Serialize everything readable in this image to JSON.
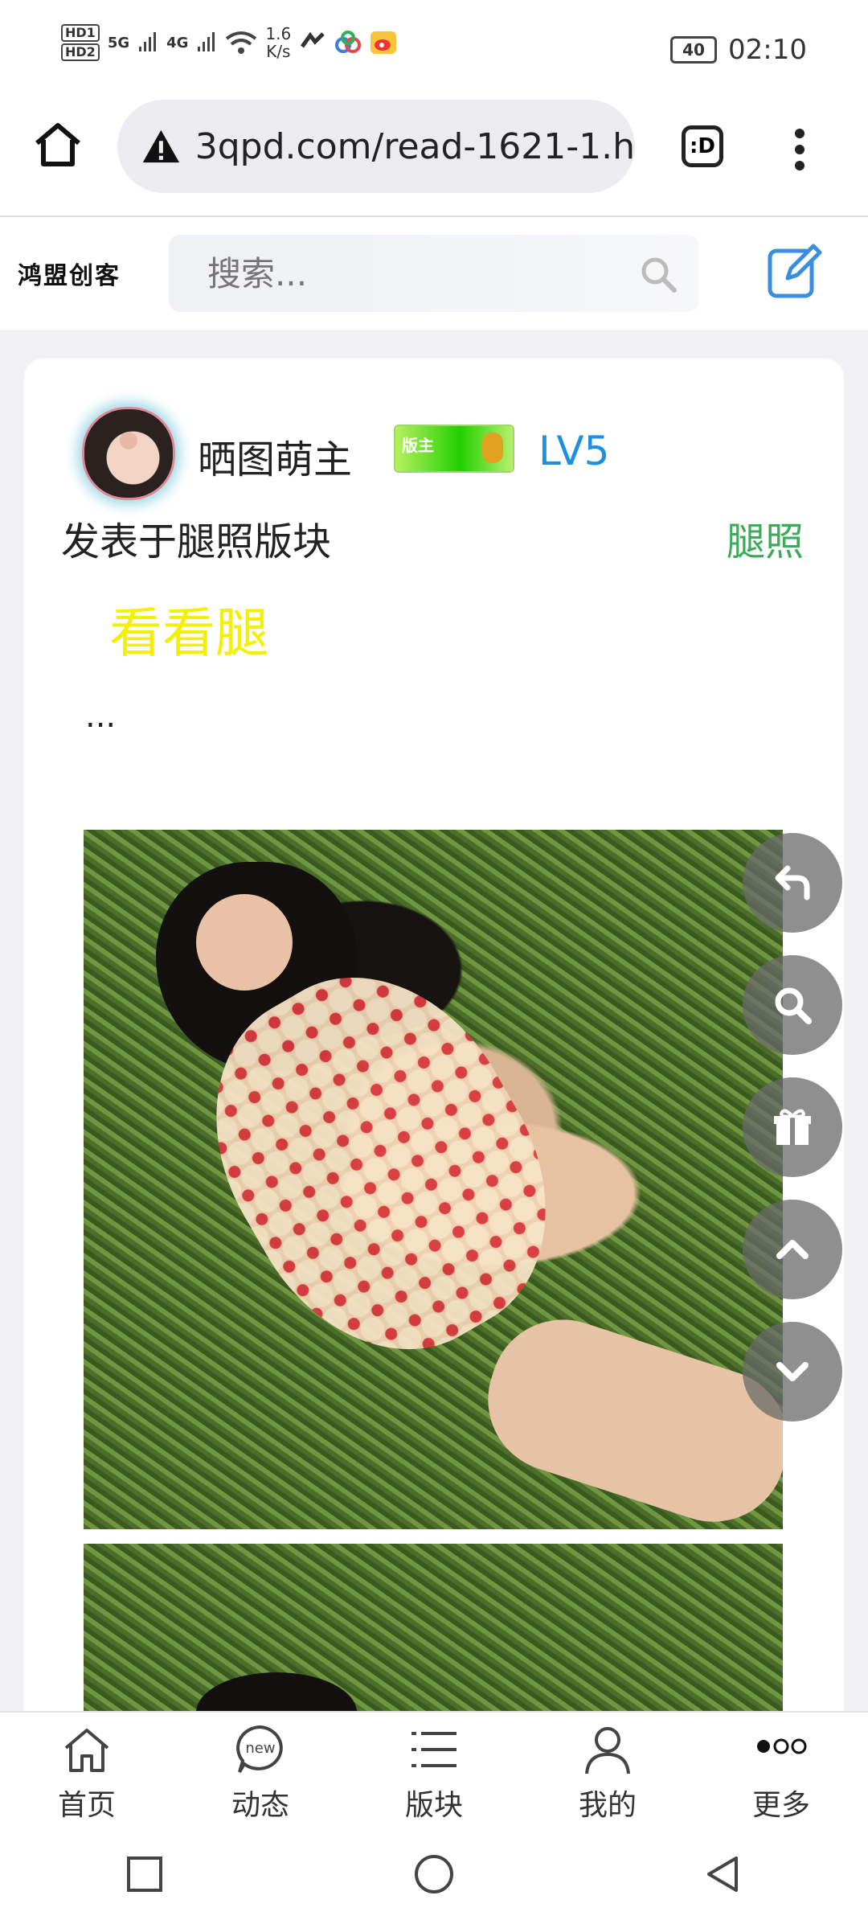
{
  "status_bar": {
    "hd1": "HD1",
    "hd2": "HD2",
    "signal1": "5G",
    "signal2": "4G",
    "net_speed_value": "1.6",
    "net_speed_unit": "K/s",
    "battery": "40",
    "time": "02:10"
  },
  "browser": {
    "url": "3qpd.com/read-1621-1.h",
    "tab_label": ":D"
  },
  "site": {
    "logo": "鸿盟创客",
    "search_placeholder": "搜索..."
  },
  "post": {
    "username": "晒图萌主",
    "badge_text": "版主",
    "level": "LV5",
    "posted_in": "发表于腿照版块",
    "tag": "腿照",
    "title": "看看腿",
    "excerpt": "...",
    "image_primary": "woman-in-floral-dress-lying-on-grass",
    "image_secondary": "woman-on-grass-cropped"
  },
  "floating_buttons": [
    "back-icon",
    "search-icon",
    "gift-icon",
    "arrow-up-icon",
    "arrow-down-icon"
  ],
  "tabs": [
    {
      "label": "首页",
      "icon": "home-icon"
    },
    {
      "label": "动态",
      "icon": "new-bubble-icon"
    },
    {
      "label": "版块",
      "icon": "list-icon"
    },
    {
      "label": "我的",
      "icon": "person-icon"
    },
    {
      "label": "更多",
      "icon": "more-dots-icon"
    }
  ],
  "colors": {
    "level": "#1e90e0",
    "tag": "#3daa5a",
    "title": "#f4f000",
    "edit_icon": "#3a8ee0"
  }
}
